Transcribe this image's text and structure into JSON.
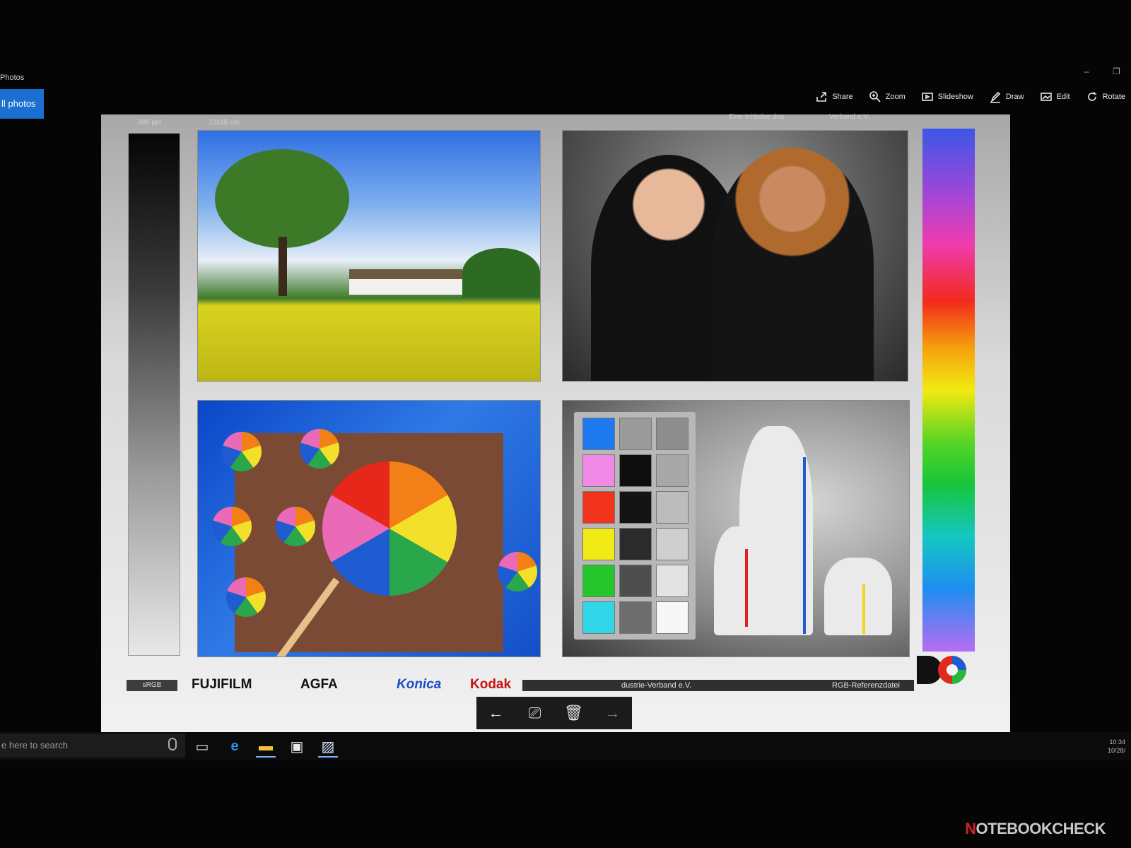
{
  "app": {
    "title": "Photos",
    "nav_label": "ll photos"
  },
  "window": {
    "minimize": "–",
    "restore": "❐"
  },
  "toolbar": [
    {
      "label": "Share",
      "icon": "share-icon"
    },
    {
      "label": "Zoom",
      "icon": "zoom-icon"
    },
    {
      "label": "Slideshow",
      "icon": "slideshow-icon"
    },
    {
      "label": "Draw",
      "icon": "draw-icon"
    },
    {
      "label": "Edit",
      "icon": "edit-icon"
    },
    {
      "label": "Rotate",
      "icon": "rotate-icon"
    }
  ],
  "sheet": {
    "ppi_note": "300 ppi",
    "size_note": "13x18 cm",
    "initiative_note": "Eine Initiative des",
    "verband_note": "Verband e.V.",
    "srgb": "sRGB",
    "brands": {
      "fujifilm": "FUJIFILM",
      "agfa": "AGFA",
      "konica": "Konica",
      "kodak": "Kodak"
    },
    "ref_left": "dustrie-Verband e.V.",
    "ref_right": "RGB-Referenzdatei",
    "swatch_colors": [
      "#1f79ef",
      "#9b9b9b",
      "#8e8e8e",
      "#f08ae6",
      "#0e0e0e",
      "#a8a8a8",
      "#f2331c",
      "#141414",
      "#bcbcbc",
      "#f2ea14",
      "#2b2b2b",
      "#cfcfcf",
      "#25c62c",
      "#4e4e4e",
      "#e3e3e3",
      "#31d7e8",
      "#6e6e6e",
      "#f7f7f7"
    ]
  },
  "nav": {
    "prev": "←",
    "slideshow": "⎚",
    "delete": "🗑",
    "next": "→"
  },
  "taskbar": {
    "search_placeholder": "e here to search",
    "tray_time": "10:34",
    "tray_date": "10/28/"
  },
  "watermark": {
    "prefix": "N",
    "text": "OTEBOOKCHECK"
  }
}
